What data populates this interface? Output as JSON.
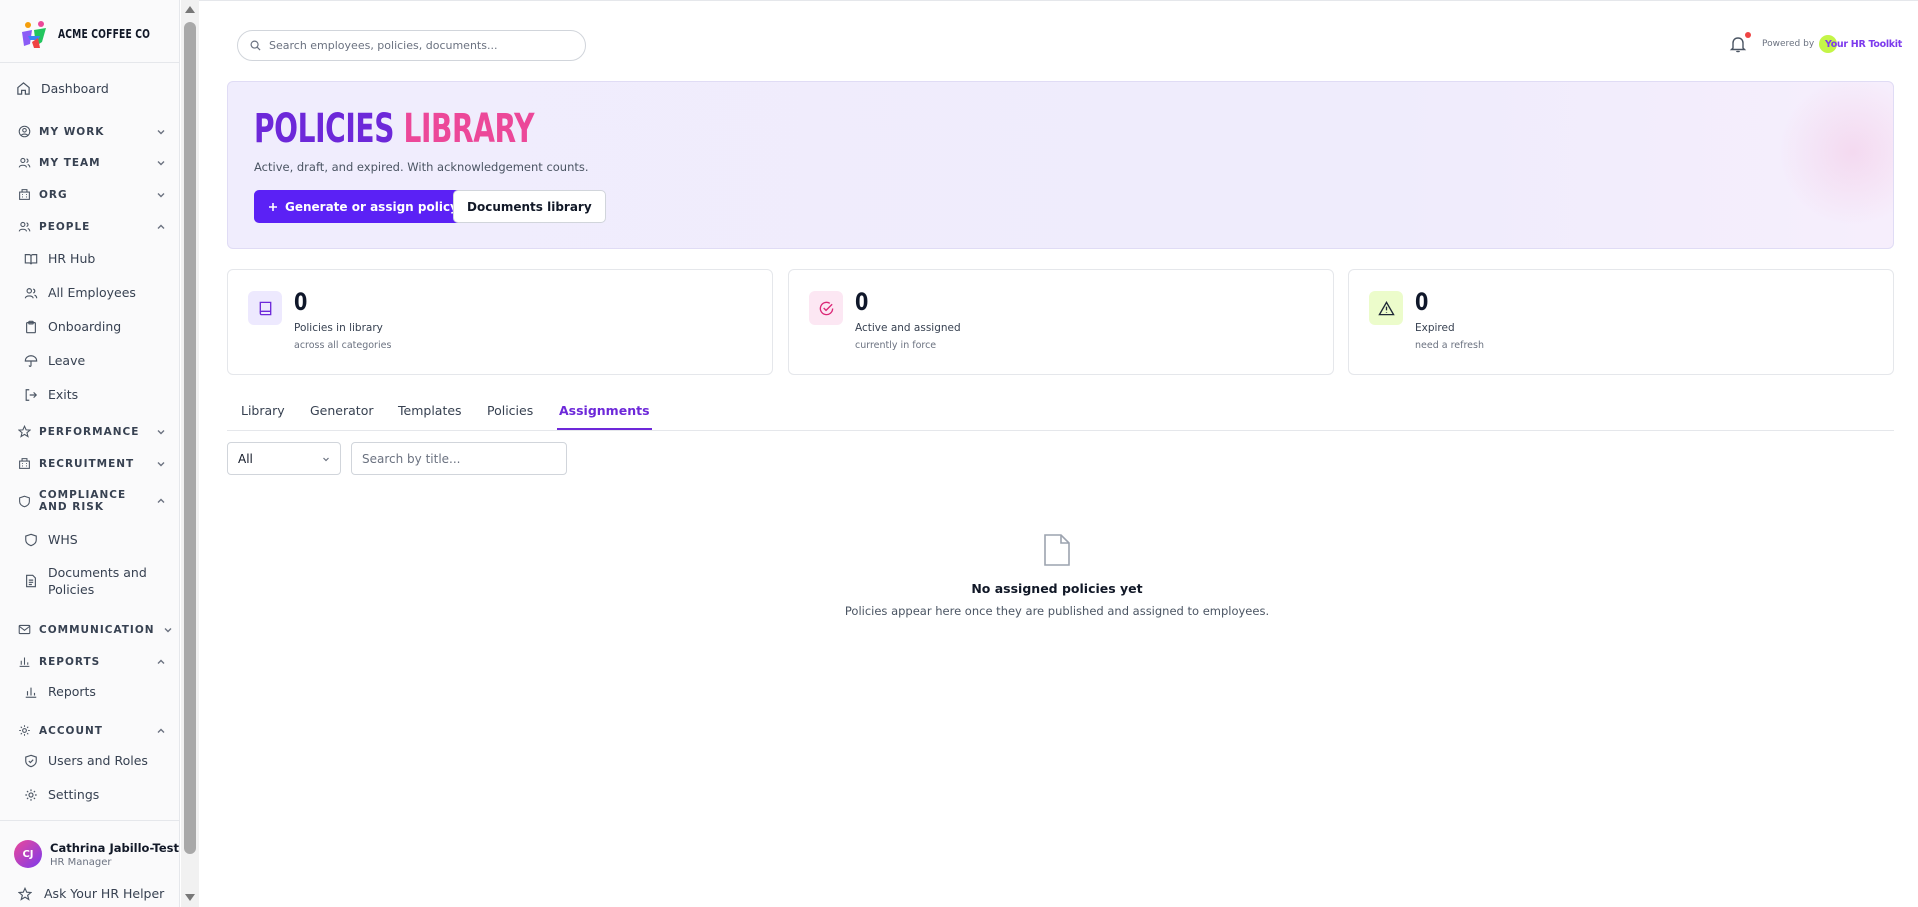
{
  "brand": {
    "name": "ACME COFFEE CO"
  },
  "sidebar": {
    "dashboard": "Dashboard",
    "sections": {
      "my_work": "MY WORK",
      "my_team": "MY TEAM",
      "org": "ORG",
      "people": "PEOPLE",
      "performance": "PERFORMANCE",
      "recruitment": "RECRUITMENT",
      "compliance": "COMPLIANCE AND RISK",
      "communication": "COMMUNICATION",
      "reports": "REPORTS",
      "account": "ACCOUNT"
    },
    "people_items": [
      "HR Hub",
      "All Employees",
      "Onboarding",
      "Leave",
      "Exits"
    ],
    "compliance_items": [
      "WHS",
      "Documents and Policies"
    ],
    "reports_items": [
      "Reports"
    ],
    "account_items": [
      "Users and Roles",
      "Settings"
    ],
    "user": {
      "initials": "CJ",
      "name": "Cathrina Jabillo-Test",
      "role": "HR Manager"
    },
    "helper": "Ask Your HR Helper"
  },
  "header": {
    "search_placeholder": "Search employees, policies, documents...",
    "powered_by": "Powered by",
    "partner_logo": "Your HR Toolkit"
  },
  "hero": {
    "title_part1": "POLICIES",
    "title_part2": "LIBRARY",
    "subtitle": "Active, draft, and expired. With acknowledgement counts.",
    "primary_button": "Generate or assign policy",
    "secondary_button": "Documents library"
  },
  "stats": [
    {
      "value": "0",
      "label": "Policies in library",
      "note": "across all categories",
      "icon": "book-icon"
    },
    {
      "value": "0",
      "label": "Active and assigned",
      "note": "currently in force",
      "icon": "check-circle-icon"
    },
    {
      "value": "0",
      "label": "Expired",
      "note": "need a refresh",
      "icon": "alert-triangle-icon"
    }
  ],
  "tabs": [
    "Library",
    "Generator",
    "Templates",
    "Policies",
    "Assignments"
  ],
  "active_tab": "Assignments",
  "filters": {
    "status_value": "All",
    "title_search_placeholder": "Search by title..."
  },
  "empty_state": {
    "title": "No assigned policies yet",
    "description": "Policies appear here once they are published and assigned to employees."
  },
  "colors": {
    "accent": "#5b21f5",
    "title_purple": "#6d28d9",
    "title_pink": "#ec4899",
    "notification": "#ef4444"
  }
}
